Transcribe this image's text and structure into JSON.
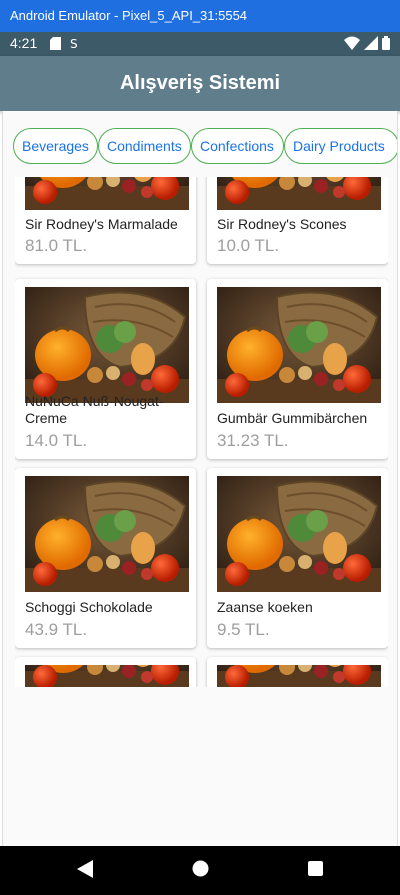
{
  "window": {
    "title": "Android Emulator - Pixel_5_API_31:5554"
  },
  "status": {
    "time": "4:21"
  },
  "app": {
    "title": "Alışveriş Sistemi"
  },
  "tabs": [
    "Beverages",
    "Condiments",
    "Confections",
    "Dairy Products"
  ],
  "products": [
    {
      "name": "Sir Rodney's Marmalade",
      "price": "81.0 TL."
    },
    {
      "name": "Sir Rodney's Scones",
      "price": "10.0 TL."
    },
    {
      "name": "NuNuCa Nuß-Nougat-Creme",
      "price": "14.0 TL."
    },
    {
      "name": "Gumbär Gummibärchen",
      "price": "31.23 TL."
    },
    {
      "name": "Schoggi Schokolade",
      "price": "43.9 TL."
    },
    {
      "name": "Zaanse koeken",
      "price": "9.5 TL."
    }
  ],
  "colors": {
    "app_bar": "#5f7d8b",
    "status_bar": "#3c5a68",
    "chip_border": "#4caf50",
    "chip_text": "#1a73e8"
  }
}
